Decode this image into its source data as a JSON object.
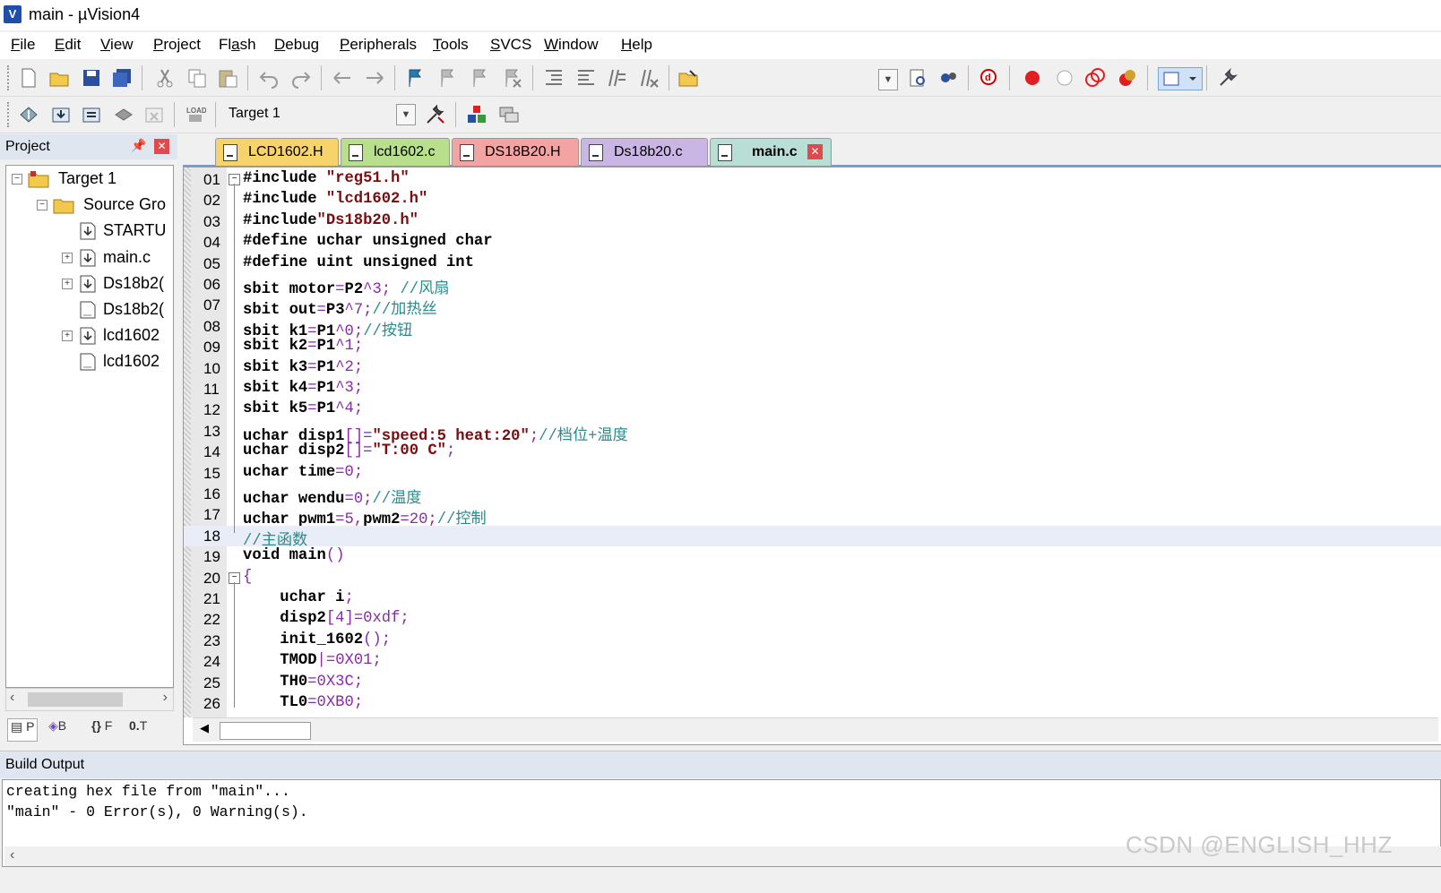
{
  "window": {
    "title": "main  - µVision4"
  },
  "menu": [
    "File",
    "Edit",
    "View",
    "Project",
    "Flash",
    "Debug",
    "Peripherals",
    "Tools",
    "SVCS",
    "Window",
    "Help"
  ],
  "menu_accel": [
    "F",
    "E",
    "V",
    "P",
    "a",
    "D",
    "P",
    "T",
    "S",
    "W",
    "H"
  ],
  "toolbar2": {
    "target": "Target 1"
  },
  "project": {
    "header": "Project",
    "tree": [
      {
        "label": "Target 1",
        "level": 0,
        "expander": "−",
        "icon": "target-folder-icon"
      },
      {
        "label": "Source Gro",
        "level": 1,
        "expander": "−",
        "icon": "folder-icon"
      },
      {
        "label": "STARTU",
        "level": 2,
        "expander": "",
        "icon": "file-modified-icon"
      },
      {
        "label": "main.c",
        "level": 2,
        "expander": "+",
        "icon": "file-modified-icon"
      },
      {
        "label": "Ds18b2(",
        "level": 2,
        "expander": "+",
        "icon": "file-modified-icon"
      },
      {
        "label": "Ds18b2(",
        "level": 2,
        "expander": "",
        "icon": "file-icon"
      },
      {
        "label": "lcd1602",
        "level": 2,
        "expander": "+",
        "icon": "file-modified-icon"
      },
      {
        "label": "lcd1602",
        "level": 2,
        "expander": "",
        "icon": "file-icon"
      }
    ],
    "bottom_tabs": [
      "P",
      "B",
      "F",
      "T"
    ]
  },
  "editor": {
    "tabs": [
      {
        "label": "LCD1602.H",
        "color": "#f7d36b"
      },
      {
        "label": "lcd1602.c",
        "color": "#b8e08c"
      },
      {
        "label": "DS18B20.H",
        "color": "#f4a3a3"
      },
      {
        "label": "Ds18b20.c",
        "color": "#c9b6e4"
      },
      {
        "label": "main.c",
        "color": "#b8ded6"
      }
    ],
    "active_tab": "main.c",
    "highlighted_line": "18",
    "lines": [
      {
        "n": "01",
        "html": "#include \"reg51.h\""
      },
      {
        "n": "02",
        "html": "#include \"lcd1602.h\""
      },
      {
        "n": "03",
        "html": "#include\"Ds18b20.h\""
      },
      {
        "n": "04",
        "html": "#define uchar unsigned char"
      },
      {
        "n": "05",
        "html": "#define uint unsigned int"
      },
      {
        "n": "06",
        "html": "sbit motor=P2^3; //风扇"
      },
      {
        "n": "07",
        "html": "sbit out=P3^7;//加热丝"
      },
      {
        "n": "08",
        "html": "sbit k1=P1^0;//按钮"
      },
      {
        "n": "09",
        "html": "sbit k2=P1^1;"
      },
      {
        "n": "10",
        "html": "sbit k3=P1^2;"
      },
      {
        "n": "11",
        "html": "sbit k4=P1^3;"
      },
      {
        "n": "12",
        "html": "sbit k5=P1^4;"
      },
      {
        "n": "13",
        "html": "uchar disp1[]=\"speed:5 heat:20\";//档位+温度"
      },
      {
        "n": "14",
        "html": "uchar disp2[]=\"T:00 C\";"
      },
      {
        "n": "15",
        "html": "uchar time=0;"
      },
      {
        "n": "16",
        "html": "uchar wendu=0;//温度"
      },
      {
        "n": "17",
        "html": "uchar pwm1=5,pwm2=20;//控制"
      },
      {
        "n": "18",
        "html": "//主函数"
      },
      {
        "n": "19",
        "html": "void main()"
      },
      {
        "n": "20",
        "html": "{"
      },
      {
        "n": "21",
        "html": "    uchar i;"
      },
      {
        "n": "22",
        "html": "    disp2[4]=0xdf;"
      },
      {
        "n": "23",
        "html": "    init_1602();"
      },
      {
        "n": "24",
        "html": "    TMOD|=0X01;"
      },
      {
        "n": "25",
        "html": "    TH0=0X3C;"
      },
      {
        "n": "26",
        "html": "    TL0=0XB0;"
      }
    ]
  },
  "build_output": {
    "header": "Build Output",
    "lines": [
      "creating hex file from \"main\"...",
      "\"main\" - 0 Error(s), 0 Warning(s)."
    ]
  },
  "watermark": "CSDN @ENGLISH_HHZ"
}
